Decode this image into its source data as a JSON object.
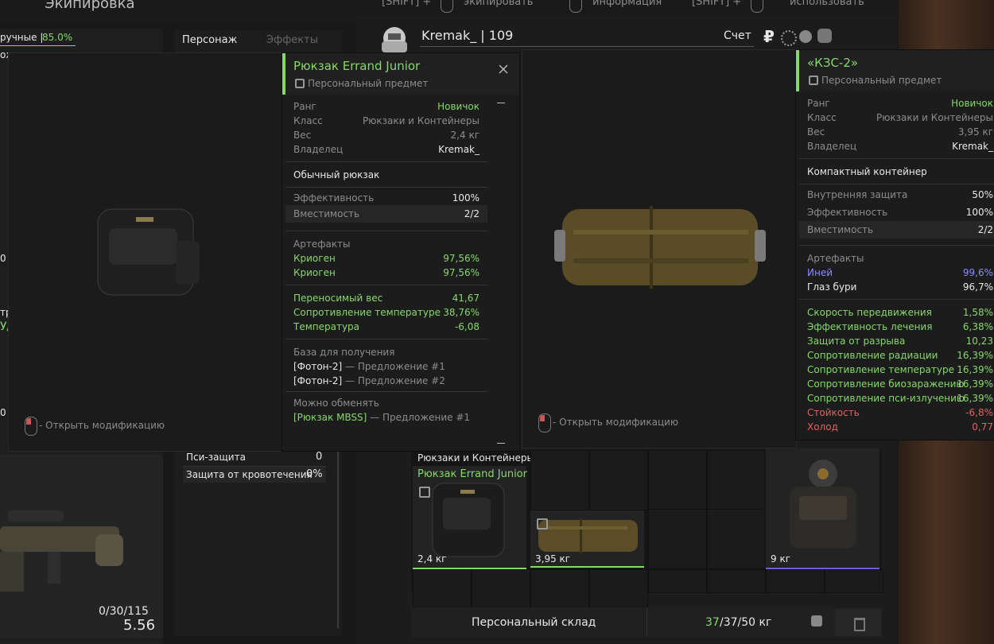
{
  "header": {
    "title": "Экипировка",
    "hint1_key": "[SHIFT] +",
    "hint1_action": "экипировать",
    "hint2_action": "информация",
    "hint3_key": "[SHIFT] +",
    "hint3_action": "использовать"
  },
  "left_panel": {
    "stat_label": "ручные |",
    "stat_value": "85.0%",
    "fragment_1": "ож",
    "fragment_2": "0",
    "fragment_3": "тр",
    "fragment_4": "У/",
    "fragment_5": "0",
    "ammo": "0/30/115",
    "caliber": "5.56"
  },
  "tabs": {
    "character": "Персонаж",
    "effects": "Эффекты"
  },
  "player": {
    "name_level": "Kremak_ | 109",
    "account_label": "Счет",
    "currency_icon": "₽"
  },
  "stats_table": {
    "psi_label": "Пси-защита",
    "psi_value": "0",
    "bleed_label": "Защита от кровотечения",
    "bleed_value": "0%"
  },
  "tooltip_left": {
    "title": "Рюкзак Errand Junior",
    "personal": "Персональный предмет",
    "rank_label": "Ранг",
    "rank_value": "Новичок",
    "class_label": "Класс",
    "class_value": "Рюкзаки и Контейнеры",
    "weight_label": "Вес",
    "weight_value": "2,4 кг",
    "owner_label": "Владелец",
    "owner_value": "Kremak_",
    "description": "Обычный рюкзак",
    "eff_label": "Эффективность",
    "eff_value": "100%",
    "cap_label": "Вместимость",
    "cap_value": "2/2",
    "art_header": "Артефакты",
    "artifacts": [
      {
        "name": "Криоген",
        "value": "97,56%"
      },
      {
        "name": "Криоген",
        "value": "97,56%"
      }
    ],
    "bonuses": [
      {
        "name": "Переносимый вес",
        "value": "41,67"
      },
      {
        "name": "Сопротивление температуре",
        "value": "38,76%"
      },
      {
        "name": "Температура",
        "value": "-6,08"
      }
    ],
    "base_header": "База для получения",
    "base_items": [
      {
        "item": "[Фотон-2]",
        "offer": " — Предложение #1"
      },
      {
        "item": "[Фотон-2]",
        "offer": " — Предложение #2"
      }
    ],
    "exchange_header": "Можно обменять",
    "exchange_item": "[Рюкзак MBSS]",
    "exchange_offer": " — Предложение #1",
    "mod_hint": "- Открыть модификацию"
  },
  "tooltip_right": {
    "title": "«КЗС-2»",
    "personal": "Персональный предмет",
    "rank_label": "Ранг",
    "rank_value": "Новичок",
    "class_label": "Класс",
    "class_value": "Рюкзаки и Контейнеры",
    "weight_label": "Вес",
    "weight_value": "3,95 кг",
    "owner_label": "Владелец",
    "owner_value": "Kremak_",
    "description": "Компактный контейнер",
    "inner_label": "Внутренняя защита",
    "inner_value": "50%",
    "eff_label": "Эффективность",
    "eff_value": "100%",
    "cap_label": "Вместимость",
    "cap_value": "2/2",
    "art_header": "Артефакты",
    "artifacts": [
      {
        "name": "Иней",
        "value": "99,6%",
        "color": "#8b8cff"
      },
      {
        "name": "Глаз бури",
        "value": "96,7%",
        "color": "#e8e8e8"
      }
    ],
    "bonuses": [
      {
        "name": "Скорость передвижения",
        "value": "1,58%",
        "color": "#86d86a"
      },
      {
        "name": "Эффективность лечения",
        "value": "6,38%",
        "color": "#86d86a"
      },
      {
        "name": "Защита от разрыва",
        "value": "10,23",
        "color": "#86d86a"
      },
      {
        "name": "Сопротивление радиации",
        "value": "16,39%",
        "color": "#86d86a"
      },
      {
        "name": "Сопротивление температуре",
        "value": "16,39%",
        "color": "#86d86a"
      },
      {
        "name": "Сопротивление биозаражению",
        "value": "16,39%",
        "color": "#86d86a"
      },
      {
        "name": "Сопротивление пси-излучению",
        "value": "16,39%",
        "color": "#86d86a"
      },
      {
        "name": "Стойкость",
        "value": "-6,8%",
        "color": "#e26161"
      },
      {
        "name": "Холод",
        "value": "0,77",
        "color": "#e26161"
      }
    ],
    "mod_hint": "- Открыть модификацию"
  },
  "inventory": {
    "category": "Рюкзаки и Контейнеры",
    "selected_name": "Рюкзак Errand Junior",
    "item1_weight": "2,4 кг",
    "item2_weight": "3,95 кг",
    "item3_weight": "9 кг"
  },
  "footer": {
    "stash_label": "Персональный склад",
    "weight_current": "37",
    "weight_rest": "/37/50 кг"
  },
  "colors": {
    "accent_green": "#86d86a",
    "artifact_blue": "#8b8cff",
    "negative_red": "#e26161"
  }
}
